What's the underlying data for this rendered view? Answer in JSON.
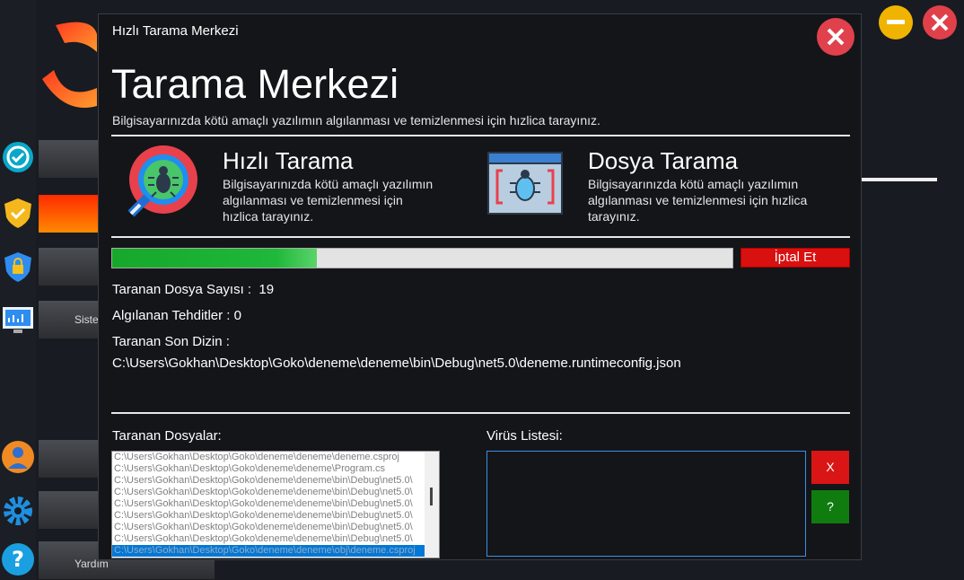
{
  "background": {
    "nav_partial_label": "Siste",
    "nav_bottom_label": "Yardım"
  },
  "dialog": {
    "window_title": "Hızlı Tarama Merkezi",
    "heading": "Tarama Merkezi",
    "subtitle": "Bilgisayarınızda kötü amaçlı yazılımın algılanması ve temizlenmesi için hızlica tarayınız.",
    "quick_scan": {
      "title": "Hızlı Tarama",
      "description": "Bilgisayarınızda kötü amaçlı yazılımın algılanması ve temizlenmesi için hızlica tarayınız."
    },
    "file_scan": {
      "title": "Dosya Tarama",
      "description": "Bilgisayarınızda kötü amaçlı yazılımın algılanması ve temizlenmesi için hızlica tarayınız."
    },
    "progress_fraction": 0.33,
    "cancel_label": "İptal Et",
    "scanned_count_label": "Taranan Dosya Sayısı :",
    "scanned_count_value": "19",
    "threats_label": "Algılanan Tehditler :",
    "threats_value": "0",
    "last_dir_label": "Taranan Son Dizin :",
    "last_dir_value": "C:\\Users\\Gokhan\\Desktop\\Goko\\deneme\\deneme\\bin\\Debug\\net5.0\\deneme.runtimeconfig.json",
    "scanned_files_label": "Taranan Dosyalar:",
    "scanned_files": [
      "C:\\Users\\Gokhan\\Desktop\\Goko\\deneme\\deneme\\deneme.csproj",
      "C:\\Users\\Gokhan\\Desktop\\Goko\\deneme\\deneme\\Program.cs",
      "C:\\Users\\Gokhan\\Desktop\\Goko\\deneme\\deneme\\bin\\Debug\\net5.0\\",
      "C:\\Users\\Gokhan\\Desktop\\Goko\\deneme\\deneme\\bin\\Debug\\net5.0\\",
      "C:\\Users\\Gokhan\\Desktop\\Goko\\deneme\\deneme\\bin\\Debug\\net5.0\\",
      "C:\\Users\\Gokhan\\Desktop\\Goko\\deneme\\deneme\\bin\\Debug\\net5.0\\",
      "C:\\Users\\Gokhan\\Desktop\\Goko\\deneme\\deneme\\bin\\Debug\\net5.0\\",
      "C:\\Users\\Gokhan\\Desktop\\Goko\\deneme\\deneme\\bin\\Debug\\net5.0\\",
      "C:\\Users\\Gokhan\\Desktop\\Goko\\deneme\\deneme\\obj\\deneme.csproj"
    ],
    "virus_list_label": "Virüs Listesi:",
    "delete_label": "X",
    "help_label": "?"
  },
  "colors": {
    "accent_red": "#d91010",
    "progress_green": "#16a82a",
    "help_green": "#107c10"
  }
}
